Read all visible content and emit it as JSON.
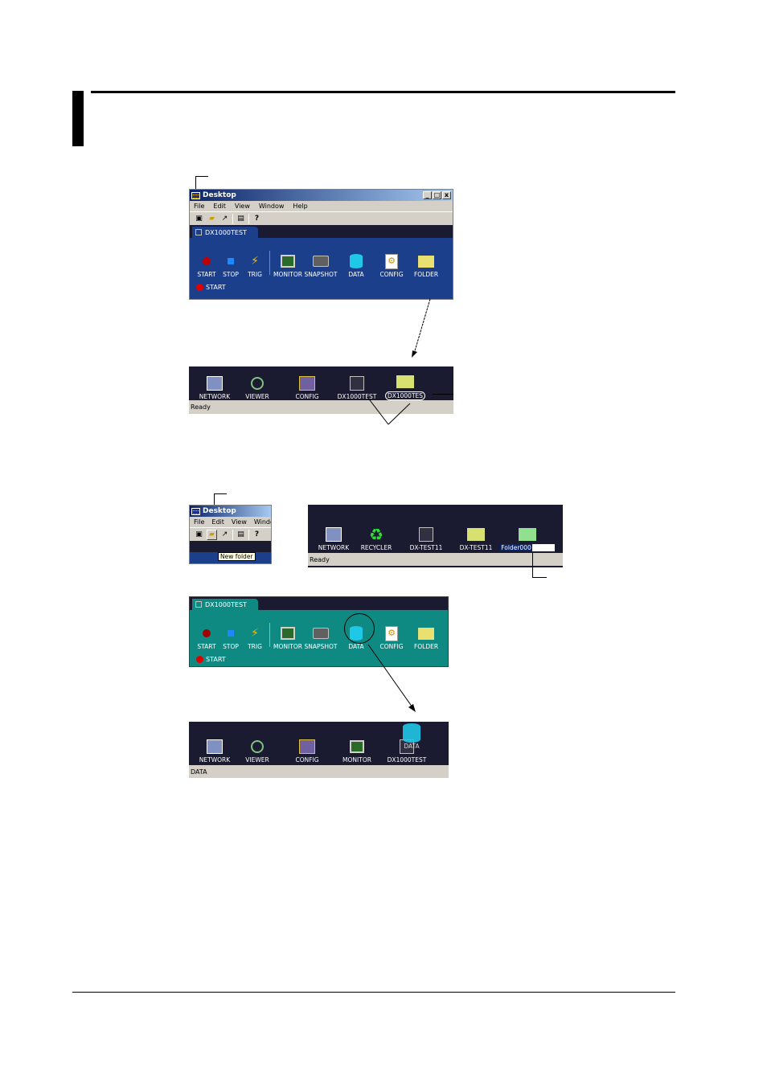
{
  "window": {
    "title": "Desktop",
    "menu": [
      "File",
      "Edit",
      "View",
      "Window",
      "Help"
    ],
    "menu_cropped": [
      "File",
      "Edit",
      "View",
      "Windo"
    ],
    "minimize": "_",
    "maximize": "□",
    "close": "x"
  },
  "recorder_panel": {
    "tab_label": "DX1000TEST",
    "commands": [
      "START",
      "STOP",
      "TRIG",
      "MONITOR",
      "SNAPSHOT",
      "DATA",
      "CONFIG",
      "FOLDER"
    ],
    "status": "START"
  },
  "desktop_bar_1": {
    "icons": [
      "NETWORK",
      "VIEWER",
      "CONFIG",
      "DX1000TEST",
      "DX1000TES"
    ],
    "status": "Ready"
  },
  "toolbar_tooltip": "New folder",
  "desktop_bar_2": {
    "icons": [
      "NETWORK",
      "RECYCLER",
      "DX-TEST11",
      "DX-TEST11"
    ],
    "rename_value": "Folder000",
    "status": "Ready"
  },
  "desktop_bar_3": {
    "icons": [
      "NETWORK",
      "VIEWER",
      "CONFIG",
      "MONITOR",
      "DX1000TEST"
    ],
    "drag_label": "DATA",
    "status": "DATA"
  },
  "colors": {
    "panel_blue": "#1c3f8c",
    "panel_teal": "#0f8a83",
    "desktop_dark": "#1a1a30"
  }
}
